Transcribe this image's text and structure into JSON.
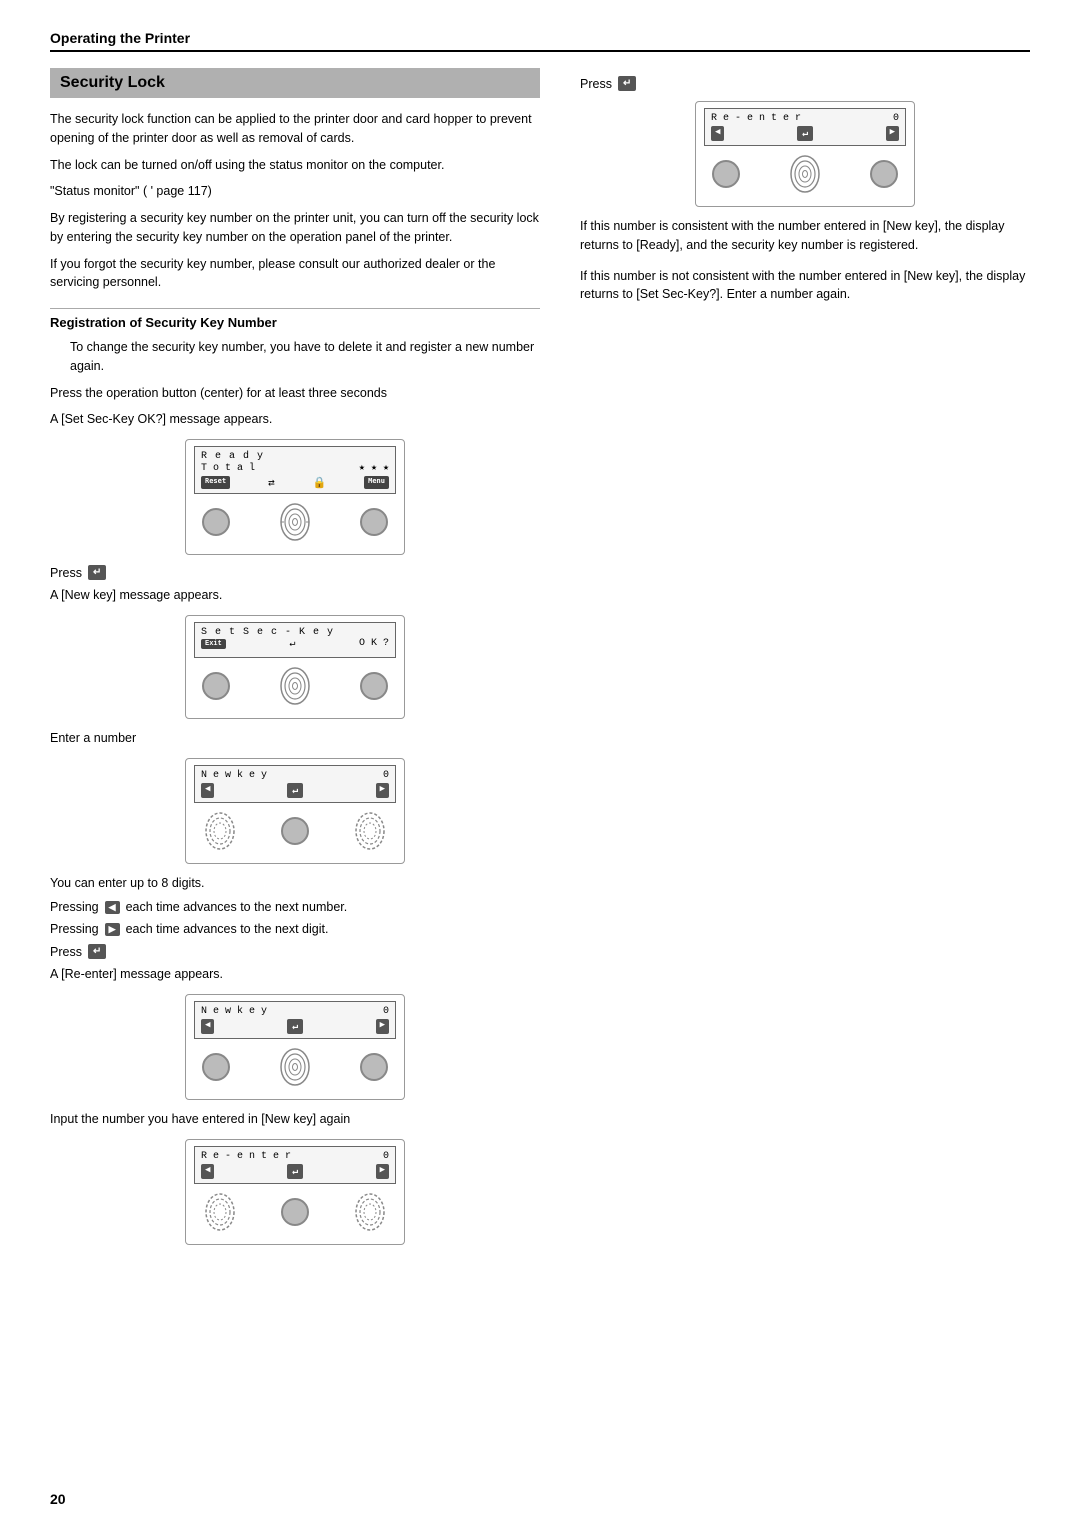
{
  "page": {
    "top_bar_title": "Operating the Printer",
    "page_number": "20"
  },
  "section": {
    "title": "Security Lock",
    "paragraphs": [
      "The security lock function can be applied to the printer door and card hopper to prevent opening of the printer door as well as removal of cards.",
      "The lock can be turned on/off using the status monitor on the computer.",
      "\"Status monitor\" (  ' page 117)",
      "By registering a security key number on the printer unit, you can turn off the security lock by entering the security key number on the operation panel of the printer.",
      "If you forgot the security key number, please consult our authorized dealer or the servicing personnel."
    ],
    "sub_heading": "Registration of Security Key Number",
    "sub_paragraphs": [
      "To change the security key number, you have to delete it and register a new number again.",
      "Press the operation button (center) for at least three seconds",
      "A [Set Sec-Key OK?] message appears."
    ],
    "press_label": "Press",
    "a_new_key_message": "A [New key] message appears.",
    "enter_a_number": "Enter a number",
    "you_can_enter": "You can enter up to 8 digits.",
    "pressing_left": "Pressing",
    "pressing_left_desc": "each time advances to the next number.",
    "pressing_right": "Pressing",
    "pressing_right_desc": "each time advances to the next digit.",
    "a_reenter_message": "A [Re-enter] message appears.",
    "input_number_text": "Input the number you have entered in [New key] again"
  },
  "right": {
    "press_label": "Press",
    "note1": "If this number is consistent with the number entered in [New key], the display returns to [Ready], and the security key number is registered.",
    "note2": "If this number is not consistent with the number entered in [New key], the display returns to [Set Sec-Key?]. Enter a number again."
  },
  "panels": {
    "ready": {
      "line1": "R e a d y",
      "line2": "T o t a l",
      "btn1": "Reset",
      "btn2": "⇄",
      "btn3": "🔒",
      "btn4": "Menu",
      "stars": "★ ★ ★"
    },
    "set_sec_key": {
      "line1": "S e t  S e c - K e y",
      "line2": "O K ?",
      "btn1": "Exit",
      "btn2": "↵"
    },
    "new_key": {
      "line1": "N e w  k e y",
      "number": "0",
      "btn_left": "◀",
      "btn_center": "↵",
      "btn_right": "▶"
    },
    "re_enter": {
      "line1": "R e - e n t e r",
      "number": "0",
      "btn_left": "◀",
      "btn_center": "↵",
      "btn_right": "▶"
    }
  }
}
